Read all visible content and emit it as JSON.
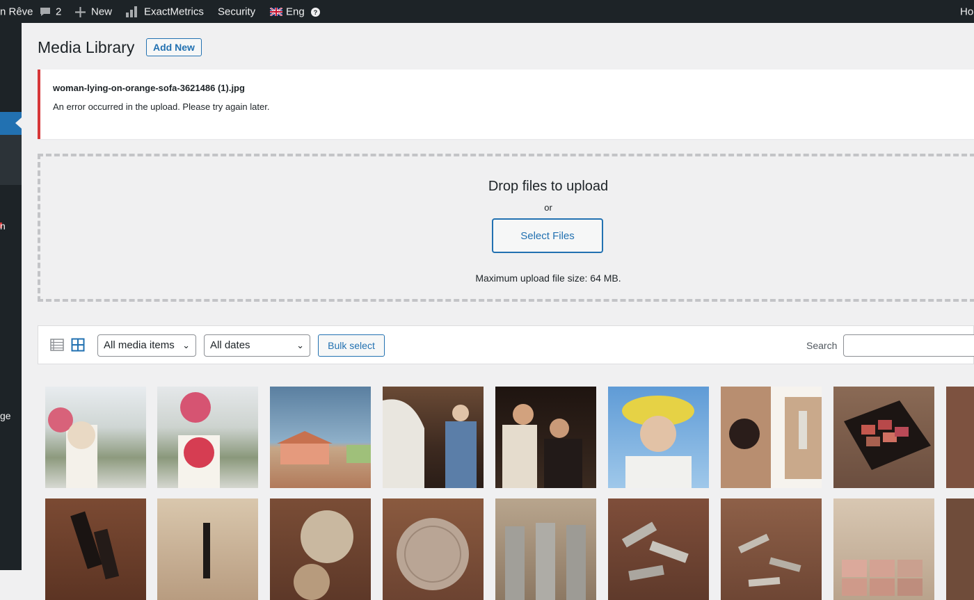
{
  "adminbar": {
    "site_name": "n Rêve",
    "comments_count": "2",
    "new_label": "New",
    "exactmetrics_label": "ExactMetrics",
    "security_label": "Security",
    "language_label": "Eng",
    "howdy_fragment": "Ho"
  },
  "sidebar": {
    "fragments": [
      "n",
      "ge"
    ]
  },
  "page": {
    "title": "Media Library",
    "add_new_label": "Add New"
  },
  "notice": {
    "filename": "woman-lying-on-orange-sofa-3621486 (1).jpg",
    "message": "An error occurred in the upload. Please try again later."
  },
  "uploader": {
    "title": "Drop files to upload",
    "or_label": "or",
    "select_files_label": "Select Files",
    "max_size_text": "Maximum upload file size: 64 MB."
  },
  "toolbar": {
    "type_filter": "All media items",
    "date_filter": "All dates",
    "bulk_select_label": "Bulk select",
    "search_label": "Search",
    "search_value": ""
  },
  "colors": {
    "accent": "#2271b1",
    "error": "#d63638",
    "admin_bar": "#1d2327"
  }
}
